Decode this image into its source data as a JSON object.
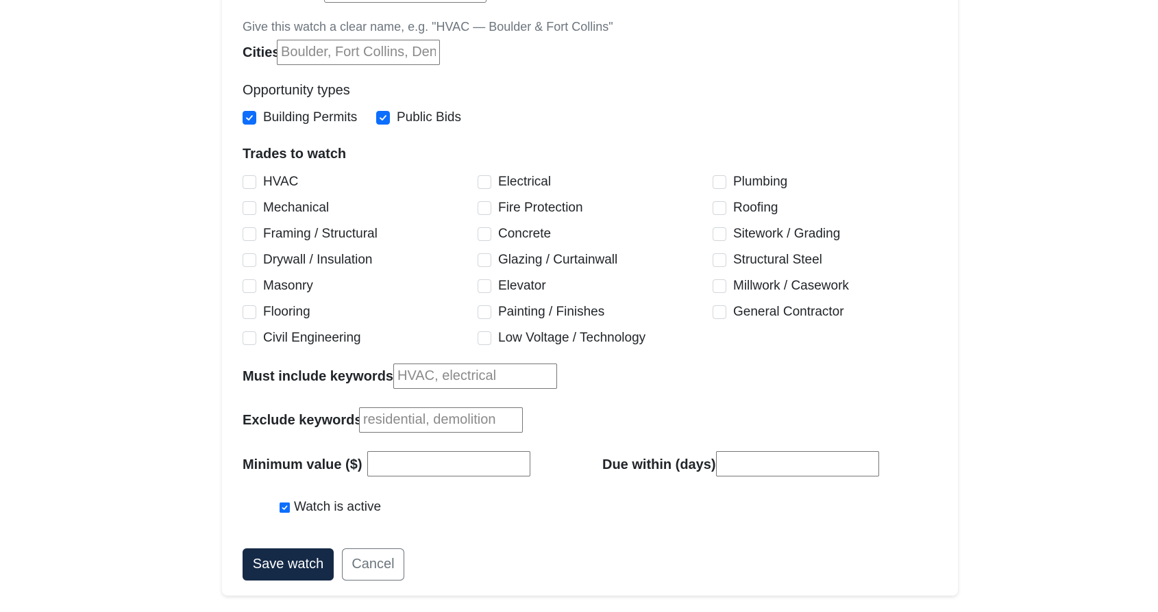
{
  "form": {
    "name_help": "Give this watch a clear name, e.g. \"HVAC — Boulder & Fort Collins\"",
    "cities_label": "Cities",
    "cities_placeholder": "Boulder, Fort Collins, Denver",
    "opportunity_title": "Opportunity types",
    "opportunity_types": [
      {
        "label": "Building Permits",
        "checked": true
      },
      {
        "label": "Public Bids",
        "checked": true
      }
    ],
    "trades_title": "Trades to watch",
    "trades": [
      {
        "label": "HVAC",
        "checked": false
      },
      {
        "label": "Electrical",
        "checked": false
      },
      {
        "label": "Plumbing",
        "checked": false
      },
      {
        "label": "Mechanical",
        "checked": false
      },
      {
        "label": "Fire Protection",
        "checked": false
      },
      {
        "label": "Roofing",
        "checked": false
      },
      {
        "label": "Framing / Structural",
        "checked": false
      },
      {
        "label": "Concrete",
        "checked": false
      },
      {
        "label": "Sitework / Grading",
        "checked": false
      },
      {
        "label": "Drywall / Insulation",
        "checked": false
      },
      {
        "label": "Glazing / Curtainwall",
        "checked": false
      },
      {
        "label": "Structural Steel",
        "checked": false
      },
      {
        "label": "Masonry",
        "checked": false
      },
      {
        "label": "Elevator",
        "checked": false
      },
      {
        "label": "Millwork / Casework",
        "checked": false
      },
      {
        "label": "Flooring",
        "checked": false
      },
      {
        "label": "Painting / Finishes",
        "checked": false
      },
      {
        "label": "General Contractor",
        "checked": false
      },
      {
        "label": "Civil Engineering",
        "checked": false
      },
      {
        "label": "Low Voltage / Technology",
        "checked": false
      }
    ],
    "include_label": "Must include keywords",
    "include_placeholder": "HVAC, electrical",
    "exclude_label": "Exclude keywords",
    "exclude_placeholder": "residential, demolition",
    "min_value_label": "Minimum value ($)",
    "min_value": "",
    "due_within_label": "Due within (days)",
    "due_within": "",
    "active_label": "Watch is active",
    "active_checked": true,
    "save_label": "Save watch",
    "cancel_label": "Cancel"
  },
  "colors": {
    "primary_button": "#152a47",
    "checkbox_checked": "#0d6efd",
    "help_text": "#6c757d"
  }
}
